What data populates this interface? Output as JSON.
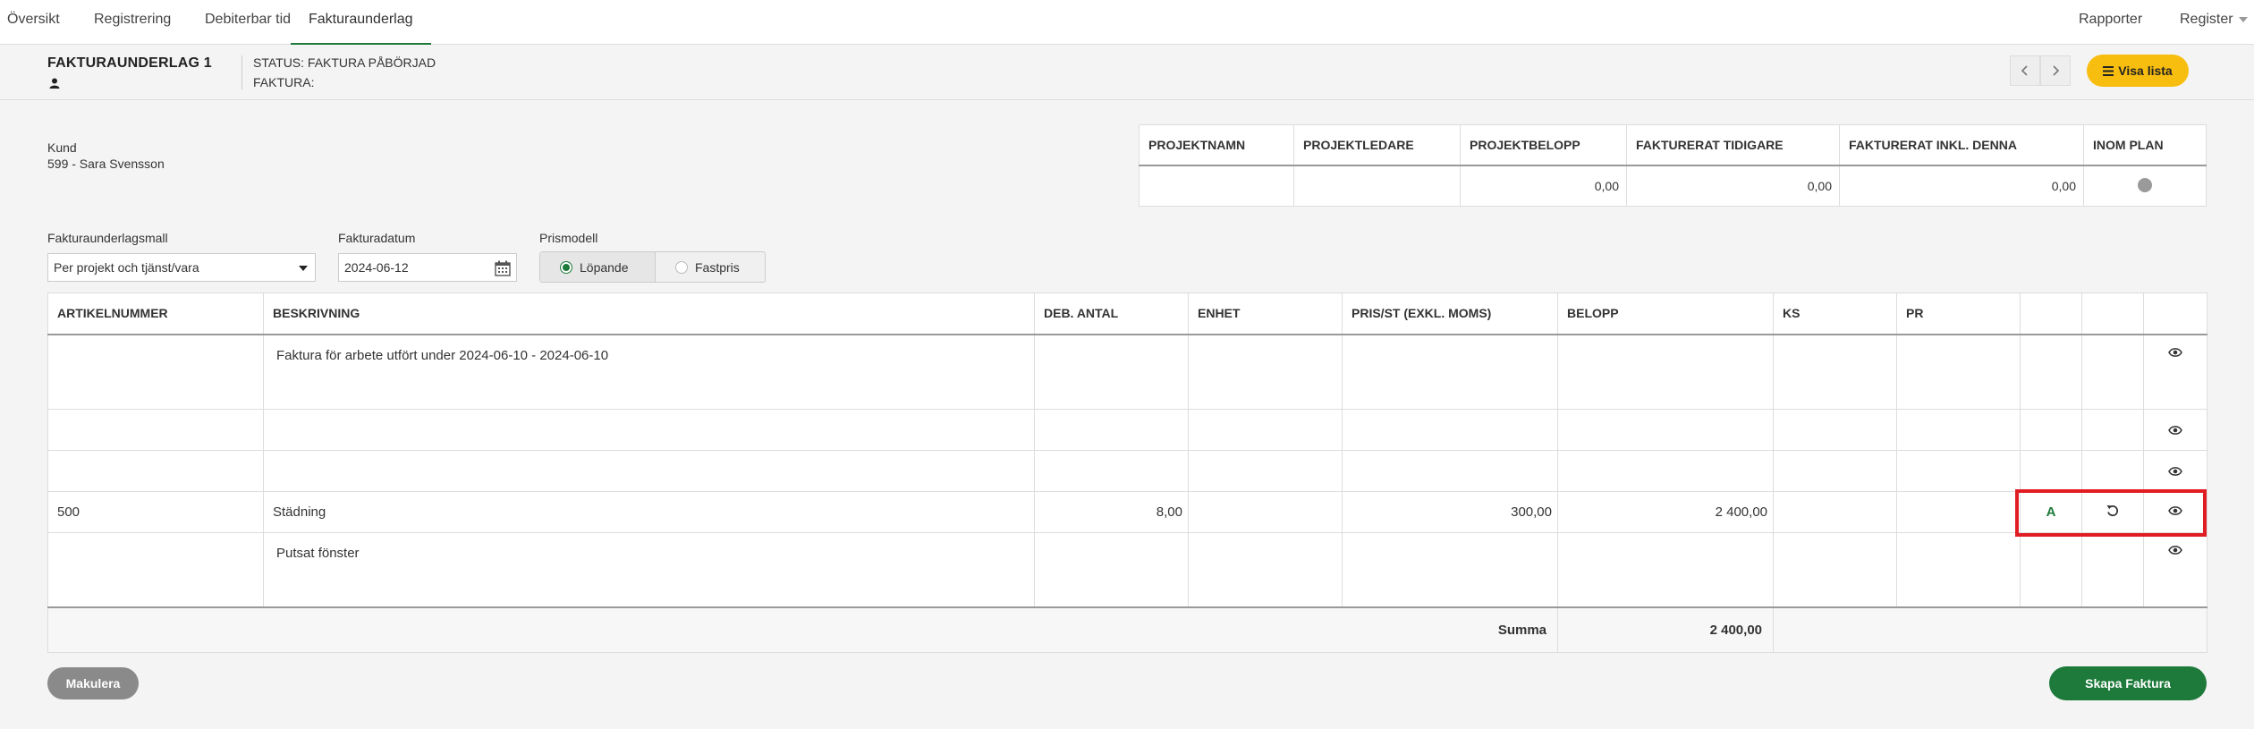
{
  "nav": {
    "tabs": [
      {
        "label": "Översikt"
      },
      {
        "label": "Registrering"
      },
      {
        "label": "Debiterbar tid"
      },
      {
        "label": "Fakturaunderlag"
      }
    ],
    "active_tab": "Fakturaunderlag",
    "right": {
      "reports": "Rapporter",
      "register": "Register"
    }
  },
  "header": {
    "title": "FAKTURAUNDERLAG 1",
    "status": "STATUS: FAKTURA PÅBÖRJAD",
    "faktura": "FAKTURA:",
    "visa_lista": "Visa lista"
  },
  "customer": {
    "label": "Kund",
    "value": "599 - Sara Svensson"
  },
  "project_table": {
    "headers": [
      "PROJEKTNAMN",
      "PROJEKTLEDARE",
      "PROJEKTBELOPP",
      "FAKTURERAT TIDIGARE",
      "FAKTURERAT INKL. DENNA",
      "INOM PLAN"
    ],
    "row": {
      "name": "",
      "manager": "",
      "amount": "0,00",
      "invoiced_before": "0,00",
      "invoiced_incl": "0,00"
    }
  },
  "form": {
    "template_label": "Fakturaunderlagsmall",
    "template_value": "Per projekt och tjänst/vara",
    "date_label": "Fakturadatum",
    "date_value": "2024-06-12",
    "price_model_label": "Prismodell",
    "price_options": [
      "Löpande",
      "Fastpris"
    ],
    "price_selected": "Löpande"
  },
  "lines_table": {
    "headers": [
      "ARTIKELNUMMER",
      "BESKRIVNING",
      "DEB. ANTAL",
      "ENHET",
      "PRIS/ST (EXKL. MOMS)",
      "BELOPP",
      "KS",
      "PR",
      "",
      "",
      ""
    ],
    "rows": [
      {
        "article": "",
        "description": "Faktura för arbete utfört under 2024-06-10 - 2024-06-10",
        "qty": "",
        "unit": "",
        "price": "",
        "amount": "",
        "ks": "",
        "pr": ""
      },
      {
        "article": "",
        "description": "",
        "qty": "",
        "unit": "",
        "price": "",
        "amount": "",
        "ks": "",
        "pr": ""
      },
      {
        "article": "",
        "description": "",
        "qty": "",
        "unit": "",
        "price": "",
        "amount": "",
        "ks": "",
        "pr": ""
      },
      {
        "article": "500",
        "description": "Städning",
        "qty": "8,00",
        "unit": "",
        "price": "300,00",
        "amount": "2 400,00",
        "ks": "",
        "pr": "",
        "mark": "A"
      },
      {
        "article": "",
        "description": "Putsat fönster",
        "qty": "",
        "unit": "",
        "price": "",
        "amount": "",
        "ks": "",
        "pr": ""
      }
    ],
    "sum_label": "Summa",
    "sum_value": "2 400,00"
  },
  "actions": {
    "makulera": "Makulera",
    "skapa": "Skapa Faktura"
  },
  "colors": {
    "accent": "#1d7a3a",
    "yellow": "#f7bd0f",
    "highlight": "#e11d24"
  }
}
